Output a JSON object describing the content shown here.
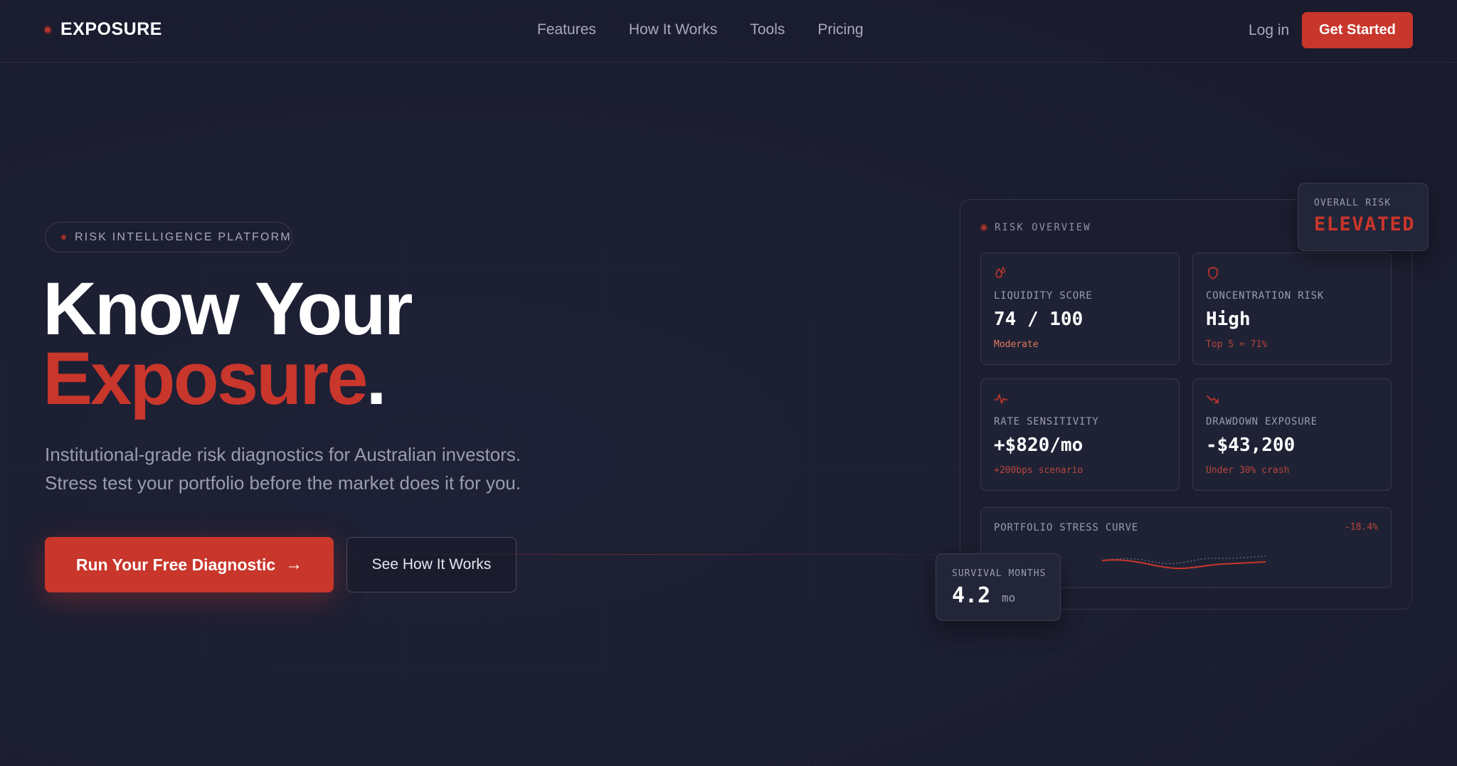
{
  "nav": {
    "logo": "EXPOSURE",
    "links": [
      "Features",
      "How It Works",
      "Tools",
      "Pricing"
    ],
    "login": "Log in",
    "cta": "Get Started"
  },
  "hero": {
    "badge": "RISK INTELLIGENCE PLATFORM",
    "title_line1": "Know Your",
    "title_red": "Exposure",
    "title_dot": ".",
    "subtitle_line1": "Institutional-grade risk diagnostics for Australian investors.",
    "subtitle_line2": "Stress test your portfolio before the market does it for you.",
    "primary_cta": "Run Your Free Diagnostic",
    "primary_cta_icon": "arrow-right-icon",
    "secondary_cta": "See How It Works"
  },
  "dashboard": {
    "title": "RISK OVERVIEW",
    "overall_risk_label": "OVERALL RISK",
    "overall_risk_value": "ELEVATED",
    "cards": [
      {
        "icon": "droplet-icon",
        "label": "LIQUIDITY SCORE",
        "value": "74 / 100",
        "note": "Moderate",
        "note_color": "#e0795c"
      },
      {
        "icon": "shield-icon",
        "label": "CONCENTRATION RISK",
        "value": "High",
        "note": "Top 5 = 71%",
        "note_color": "#b8453a"
      },
      {
        "icon": "pulse-icon",
        "label": "RATE SENSITIVITY",
        "value": "+$820/mo",
        "note": "+200bps scenario",
        "note_color": "#b8453a"
      },
      {
        "icon": "trend-down-icon",
        "label": "DRAWDOWN EXPOSURE",
        "value": "-$43,200",
        "note": "Under 30% crash",
        "note_color": "#b8453a"
      }
    ],
    "stress_curve": {
      "label": "PORTFOLIO STRESS CURVE",
      "change": "-18.4%"
    },
    "survival": {
      "label": "SURVIVAL MONTHS",
      "value": "4.2",
      "unit": "mo"
    }
  },
  "colors": {
    "accent": "#c9362b",
    "background": "#1b1d30",
    "card": "#202236",
    "muted_text": "#9a9db0"
  }
}
